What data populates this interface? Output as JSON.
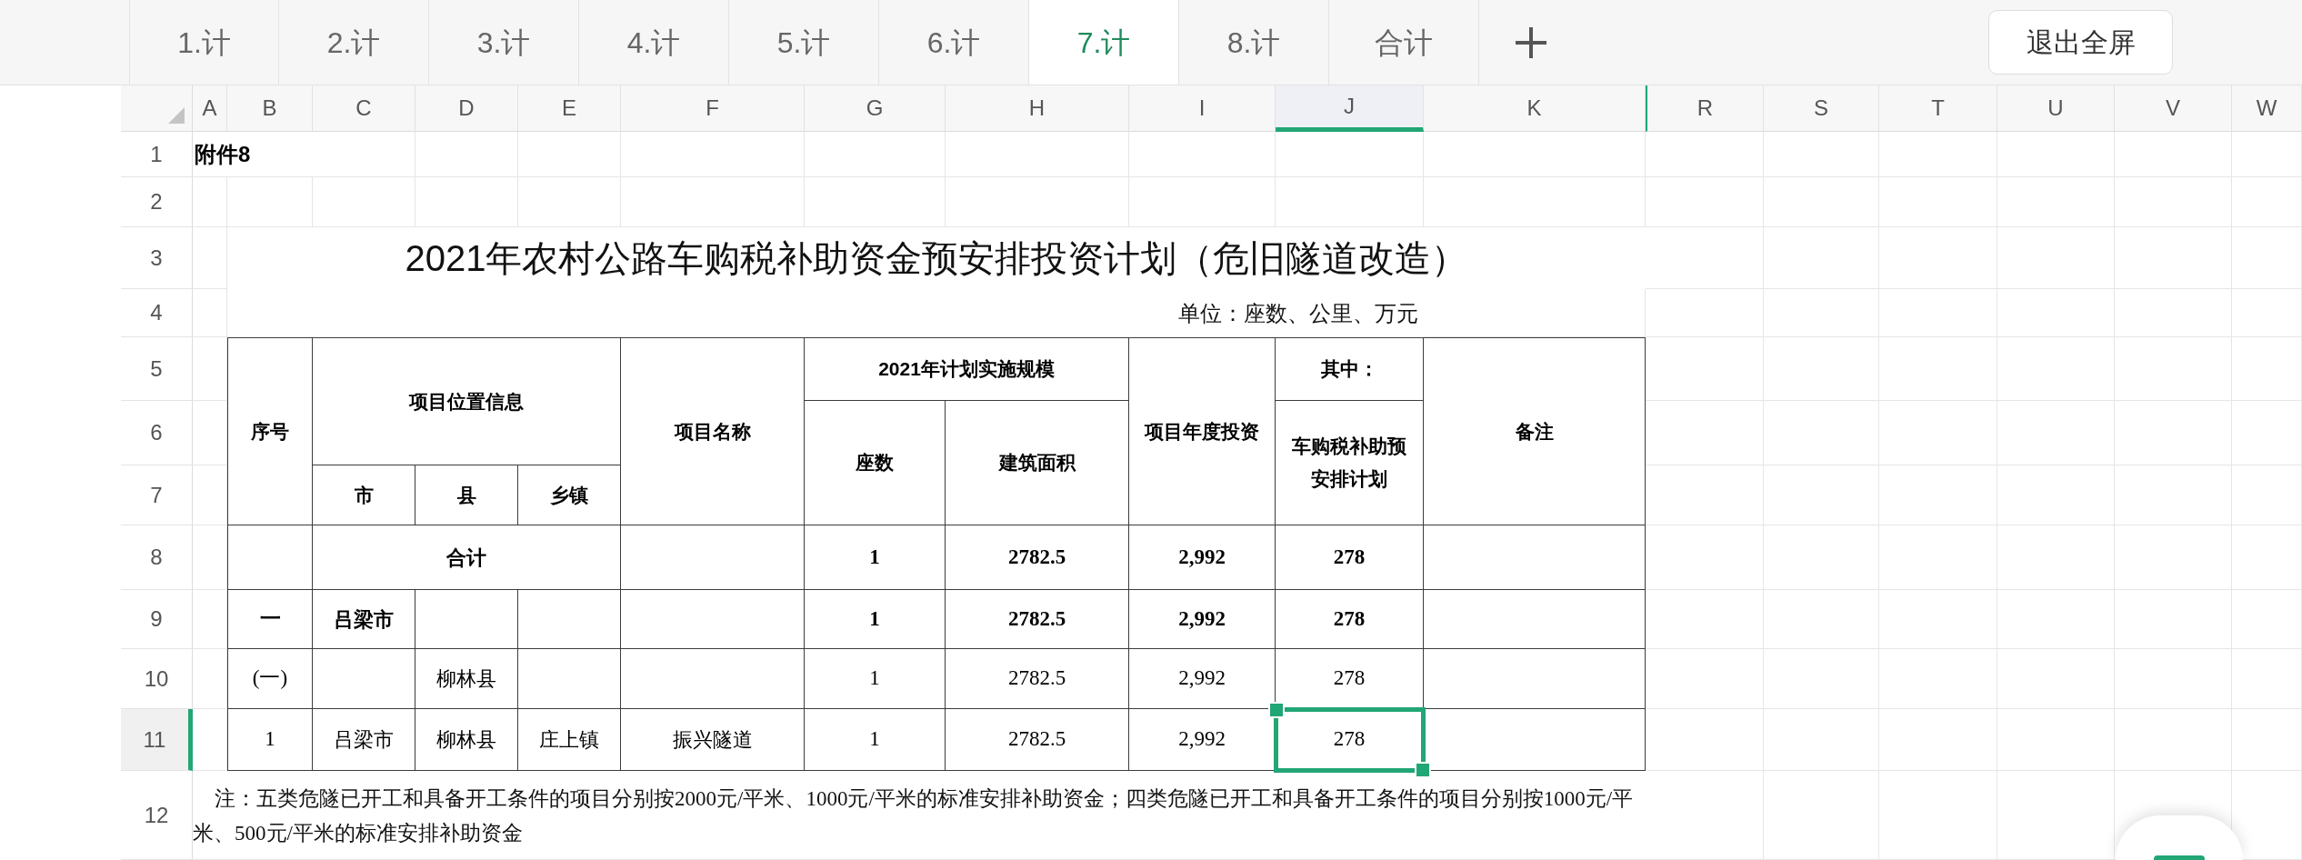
{
  "sheet_tabs": [
    {
      "label": "1.计",
      "selected": false
    },
    {
      "label": "2.计",
      "selected": false
    },
    {
      "label": "3.计",
      "selected": false
    },
    {
      "label": "4.计",
      "selected": false
    },
    {
      "label": "5.计",
      "selected": false
    },
    {
      "label": "6.计",
      "selected": false
    },
    {
      "label": "7.计",
      "selected": true
    },
    {
      "label": "8.计",
      "selected": false
    },
    {
      "label": "合计",
      "selected": false
    }
  ],
  "exit_fullscreen_button": "退出全屏",
  "column_headers": [
    {
      "label": "A",
      "selected": false
    },
    {
      "label": "B",
      "selected": false
    },
    {
      "label": "C",
      "selected": false
    },
    {
      "label": "D",
      "selected": false
    },
    {
      "label": "E",
      "selected": false
    },
    {
      "label": "F",
      "selected": false
    },
    {
      "label": "G",
      "selected": false
    },
    {
      "label": "H",
      "selected": false
    },
    {
      "label": "I",
      "selected": false
    },
    {
      "label": "J",
      "selected": true
    },
    {
      "label": "K",
      "selected": false
    },
    {
      "label": "R",
      "selected": false
    },
    {
      "label": "S",
      "selected": false
    },
    {
      "label": "T",
      "selected": false
    },
    {
      "label": "U",
      "selected": false
    },
    {
      "label": "V",
      "selected": false
    },
    {
      "label": "W",
      "selected": false
    }
  ],
  "row_headers": [
    {
      "label": "1",
      "selected": false
    },
    {
      "label": "2",
      "selected": false
    },
    {
      "label": "3",
      "selected": false
    },
    {
      "label": "4",
      "selected": false
    },
    {
      "label": "5",
      "selected": false
    },
    {
      "label": "6",
      "selected": false
    },
    {
      "label": "7",
      "selected": false
    },
    {
      "label": "8",
      "selected": false
    },
    {
      "label": "9",
      "selected": false
    },
    {
      "label": "10",
      "selected": false
    },
    {
      "label": "11",
      "selected": true
    },
    {
      "label": "12",
      "selected": false
    }
  ],
  "attachment_label": "附件8",
  "title": "2021年农村公路车购税补助资金预安排投资计划（危旧隧道改造）",
  "unit_note": "单位：座数、公里、万元",
  "table": {
    "headers": [
      {
        "label": "序号"
      },
      {
        "label": "项目位置信息",
        "children": [
          {
            "label": "市"
          },
          {
            "label": "县"
          },
          {
            "label": "乡镇"
          }
        ]
      },
      {
        "label": "项目名称"
      },
      {
        "label": "2021年计划实施规模",
        "children": [
          {
            "label": "座数"
          },
          {
            "label": "建筑面积"
          }
        ]
      },
      {
        "label": "项目年度投资"
      },
      {
        "label": "其中：",
        "children": [
          {
            "label": "车购税补助预安排计划"
          }
        ]
      },
      {
        "label": "备注"
      }
    ],
    "rows": [
      {
        "kind": "total",
        "label": "合计",
        "count": "1",
        "area": "2782.5",
        "investment": "2,992",
        "subsidy": "278",
        "bold": true,
        "selected": false
      },
      {
        "kind": "item",
        "seq": "一",
        "city": "吕梁市",
        "count": "1",
        "area": "2782.5",
        "investment": "2,992",
        "subsidy": "278",
        "bold": true,
        "selected": false
      },
      {
        "kind": "item",
        "seq": "(一)",
        "county": "柳林县",
        "count": "1",
        "area": "2782.5",
        "investment": "2,992",
        "subsidy": "278",
        "bold": false,
        "selected": false
      },
      {
        "kind": "item",
        "seq": "1",
        "city": "吕梁市",
        "county": "柳林县",
        "town": "庄上镇",
        "name": "振兴隧道",
        "count": "1",
        "area": "2782.5",
        "investment": "2,992",
        "subsidy": "278",
        "bold": false,
        "selected": true
      }
    ]
  },
  "note": "注：五类危隧已开工和具备开工条件的项目分别按2000元/平米、1000元/平米的标准安排补助资金；四类危隧已开工和具备开工条件的项目分别按1000元/平米、500元/平米的标准安排补助资金"
}
